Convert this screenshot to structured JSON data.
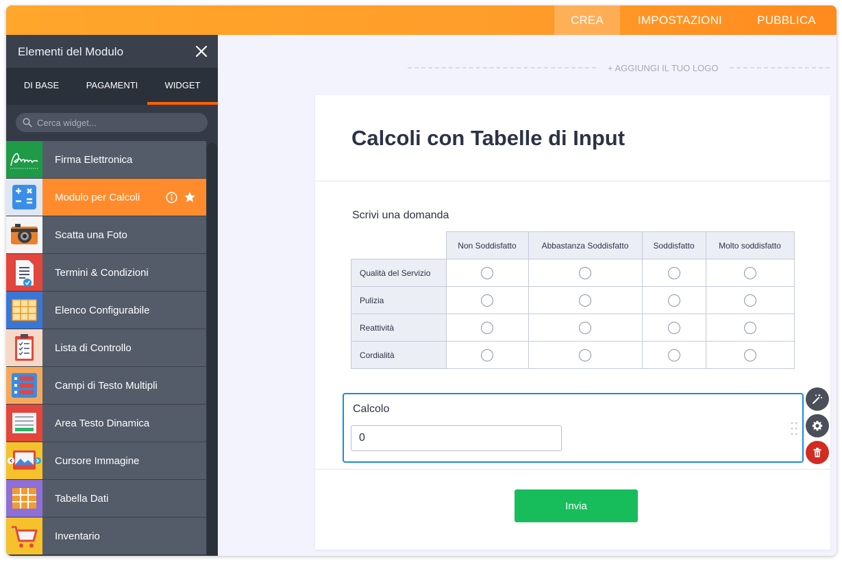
{
  "topnav": {
    "tabs": [
      {
        "label": "CREA",
        "active": true
      },
      {
        "label": "IMPOSTAZIONI",
        "active": false
      },
      {
        "label": "PUBBLICA",
        "active": false
      }
    ]
  },
  "sidebar": {
    "title": "Elementi del Modulo",
    "close_icon": "close-icon",
    "tabs": [
      {
        "label": "DI BASE",
        "active": false
      },
      {
        "label": "PAGAMENTI",
        "active": false
      },
      {
        "label": "WIDGET",
        "active": true
      }
    ],
    "search": {
      "placeholder": "Cerca widget..."
    },
    "items": [
      {
        "label": "Firma Elettronica",
        "icon": "signature-icon"
      },
      {
        "label": "Modulo per Calcoli",
        "icon": "calculator-icon",
        "active": true
      },
      {
        "label": "Scatta una Foto",
        "icon": "camera-icon"
      },
      {
        "label": "Termini & Condizioni",
        "icon": "terms-document-icon"
      },
      {
        "label": "Elenco Configurabile",
        "icon": "configurable-list-icon"
      },
      {
        "label": "Lista di Controllo",
        "icon": "checklist-icon"
      },
      {
        "label": "Campi di Testo Multipli",
        "icon": "multiple-text-fields-icon"
      },
      {
        "label": "Area Testo Dinamica",
        "icon": "dynamic-textarea-icon"
      },
      {
        "label": "Cursore Immagine",
        "icon": "image-slider-icon"
      },
      {
        "label": "Tabella Dati",
        "icon": "data-table-icon"
      },
      {
        "label": "Inventario",
        "icon": "shopping-cart-icon"
      }
    ],
    "accent_color": "#ff8b2c"
  },
  "main": {
    "logo_placeholder": "+ AGGIUNGI IL TUO LOGO",
    "form": {
      "title": "Calcoli con Tabelle di Input",
      "question": "Scrivi una domanda",
      "matrix": {
        "columns": [
          "Non Soddisfatto",
          "Abbastanza Soddisfatto",
          "Soddisfatto",
          "Molto soddisfatto"
        ],
        "rows": [
          "Qualità del Servizio",
          "Pulizia",
          "Reattività",
          "Cordialità"
        ]
      },
      "calc": {
        "label": "Calcolo",
        "value": "0"
      },
      "submit_label": "Invia"
    },
    "controls": [
      {
        "icon": "magic-wand-icon",
        "color": "#4a4f5a"
      },
      {
        "icon": "gear-icon",
        "color": "#4a4f5a"
      },
      {
        "icon": "trash-icon",
        "color": "#d22b21"
      }
    ]
  }
}
